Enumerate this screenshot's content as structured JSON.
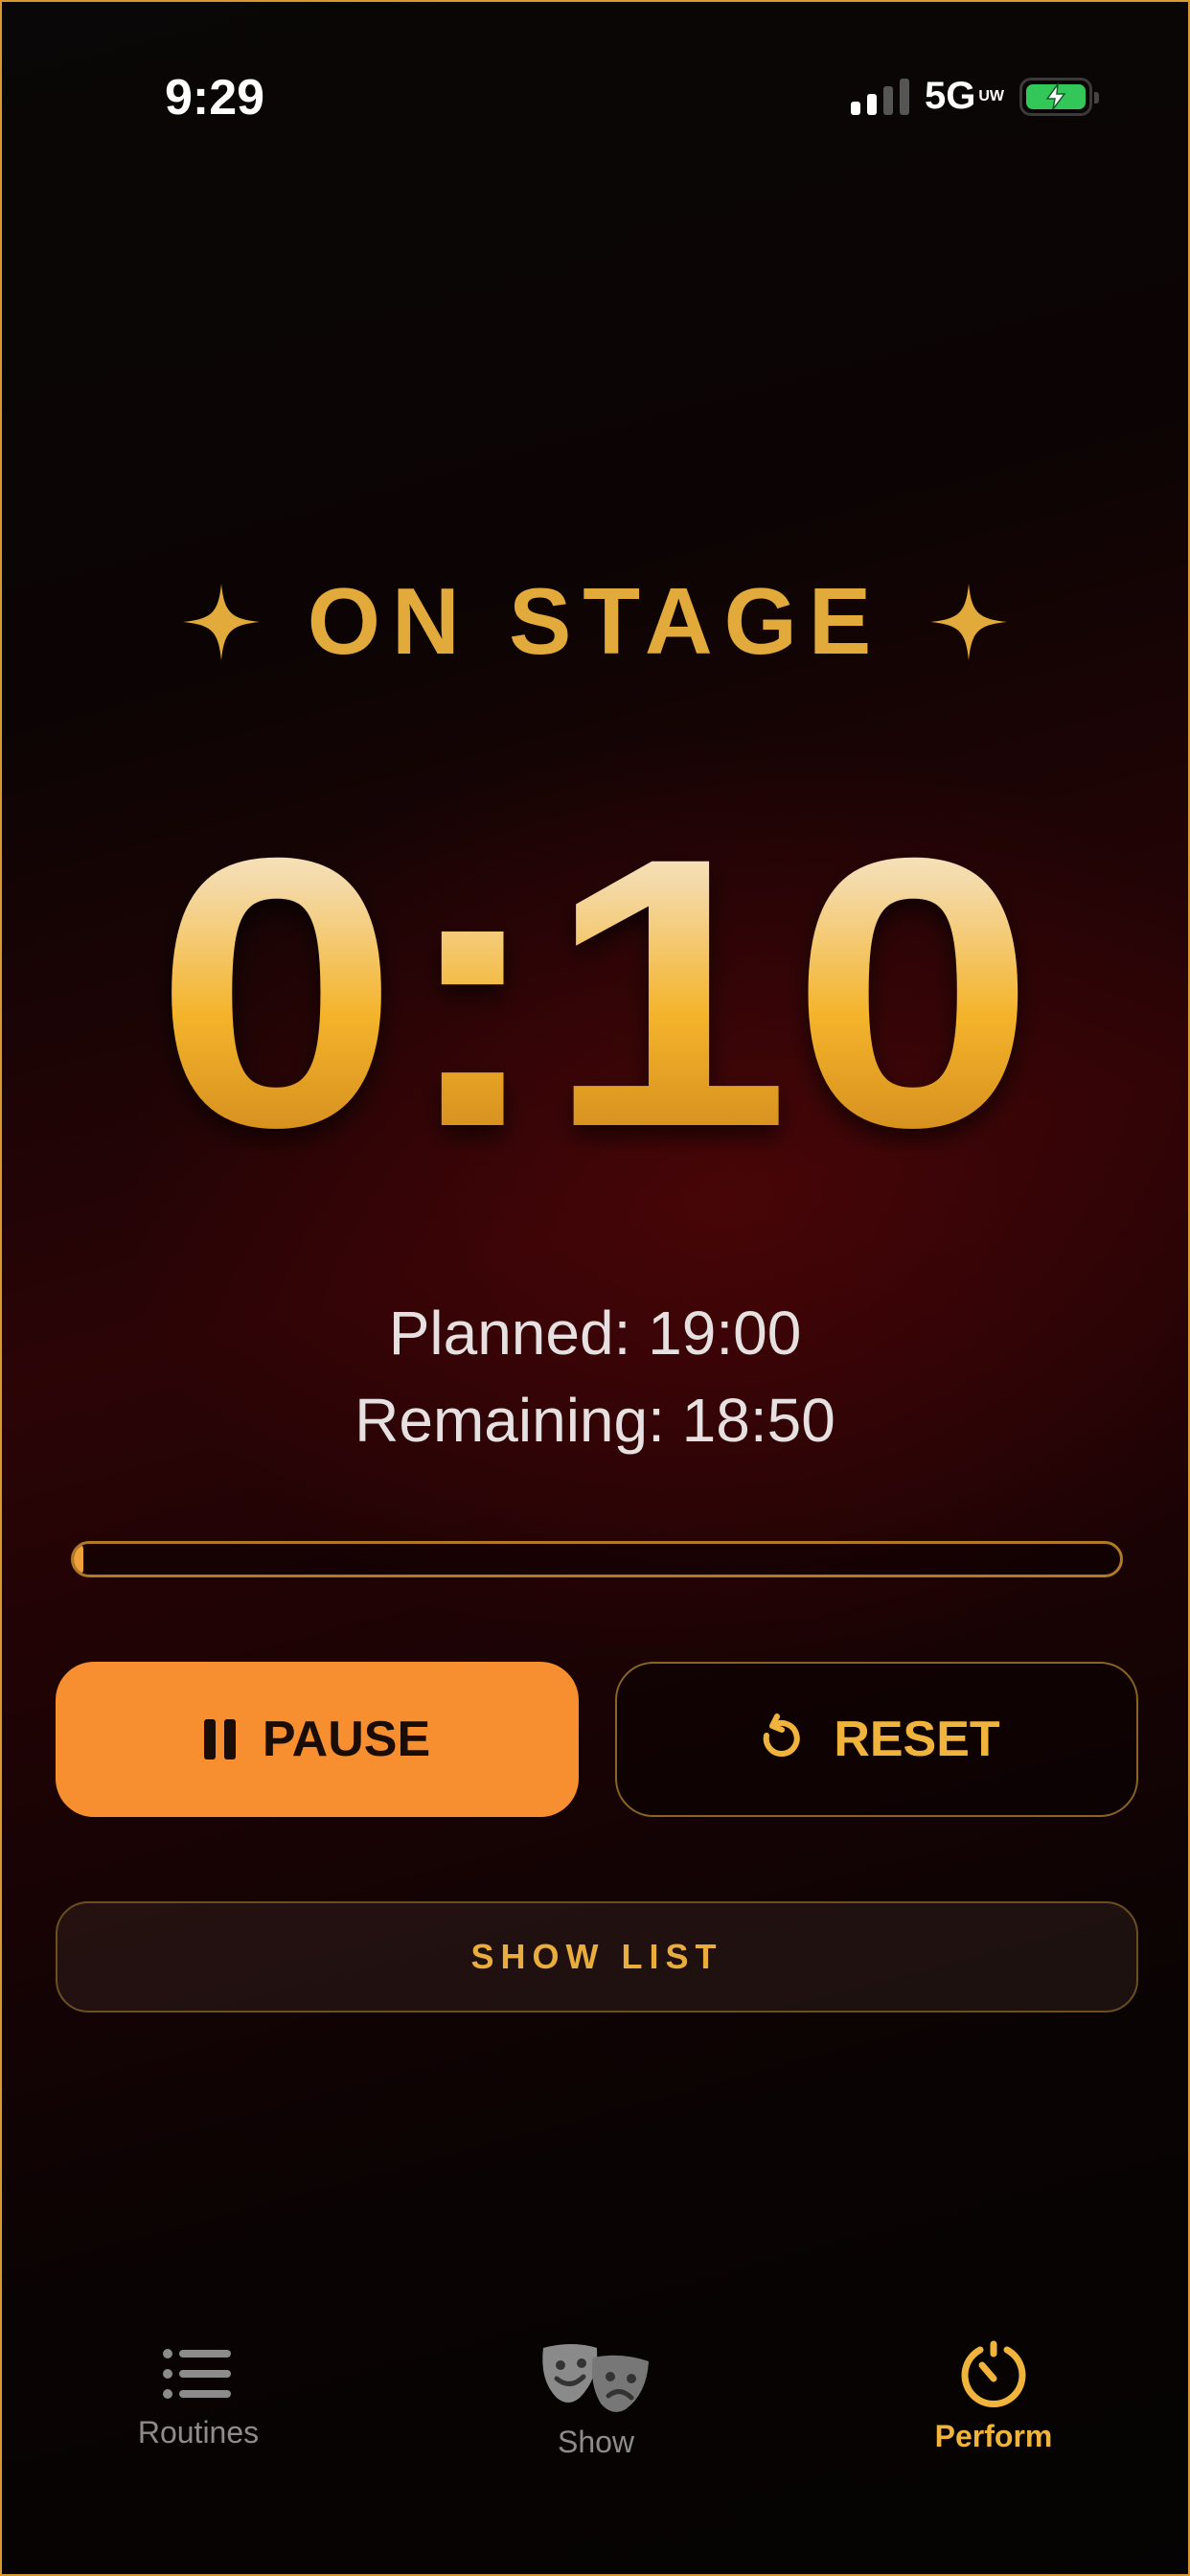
{
  "status_bar": {
    "time": "9:29",
    "network": "5G",
    "network_badge": "UW",
    "battery_state": "charging"
  },
  "header": {
    "title": "ON STAGE"
  },
  "timer": {
    "elapsed": "0:10",
    "planned_label": "Planned: 19:00",
    "remaining_label": "Remaining: 18:50",
    "progress_fraction": 0.009
  },
  "controls": {
    "pause_label": "PAUSE",
    "reset_label": "RESET",
    "show_list_label": "SHOW LIST"
  },
  "tab_bar": {
    "items": [
      {
        "label": "Routines",
        "icon": "list-icon",
        "active": false
      },
      {
        "label": "Show",
        "icon": "theater-masks-icon",
        "active": false
      },
      {
        "label": "Perform",
        "icon": "timer-icon",
        "active": true
      }
    ]
  },
  "colors": {
    "accent_gold": "#e2a93b",
    "pause_orange": "#f78f31",
    "background_red": "#2b0406"
  }
}
